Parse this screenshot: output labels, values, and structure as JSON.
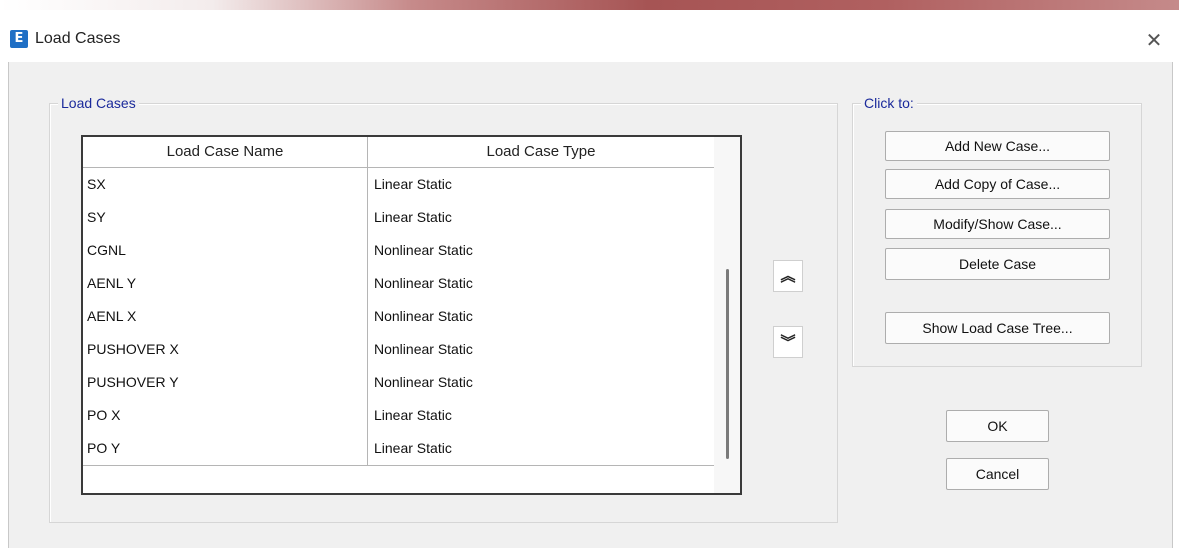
{
  "window": {
    "title": "Load Cases",
    "app_icon_glyph": "E",
    "close_glyph": "✕"
  },
  "load_cases_group": {
    "legend": "Load Cases"
  },
  "grid": {
    "columns": [
      "Load Case Name",
      "Load Case Type"
    ],
    "rows": [
      {
        "name": "SX",
        "type": "Linear Static"
      },
      {
        "name": "SY",
        "type": "Linear Static"
      },
      {
        "name": "CGNL",
        "type": "Nonlinear Static"
      },
      {
        "name": "AENL Y",
        "type": "Nonlinear Static"
      },
      {
        "name": "AENL X",
        "type": "Nonlinear Static"
      },
      {
        "name": "PUSHOVER X",
        "type": "Nonlinear Static"
      },
      {
        "name": "PUSHOVER Y",
        "type": "Nonlinear Static"
      },
      {
        "name": "PO X",
        "type": "Linear Static"
      },
      {
        "name": "PO Y",
        "type": "Linear Static"
      }
    ]
  },
  "move_up_glyph": "︽",
  "move_down_glyph": "︾",
  "click_to_group": {
    "legend": "Click to:",
    "buttons": {
      "add_new": "Add New Case...",
      "add_copy": "Add Copy of Case...",
      "modify_show": "Modify/Show Case...",
      "delete": "Delete Case",
      "show_tree": "Show Load Case Tree..."
    }
  },
  "ok_label": "OK",
  "cancel_label": "Cancel"
}
